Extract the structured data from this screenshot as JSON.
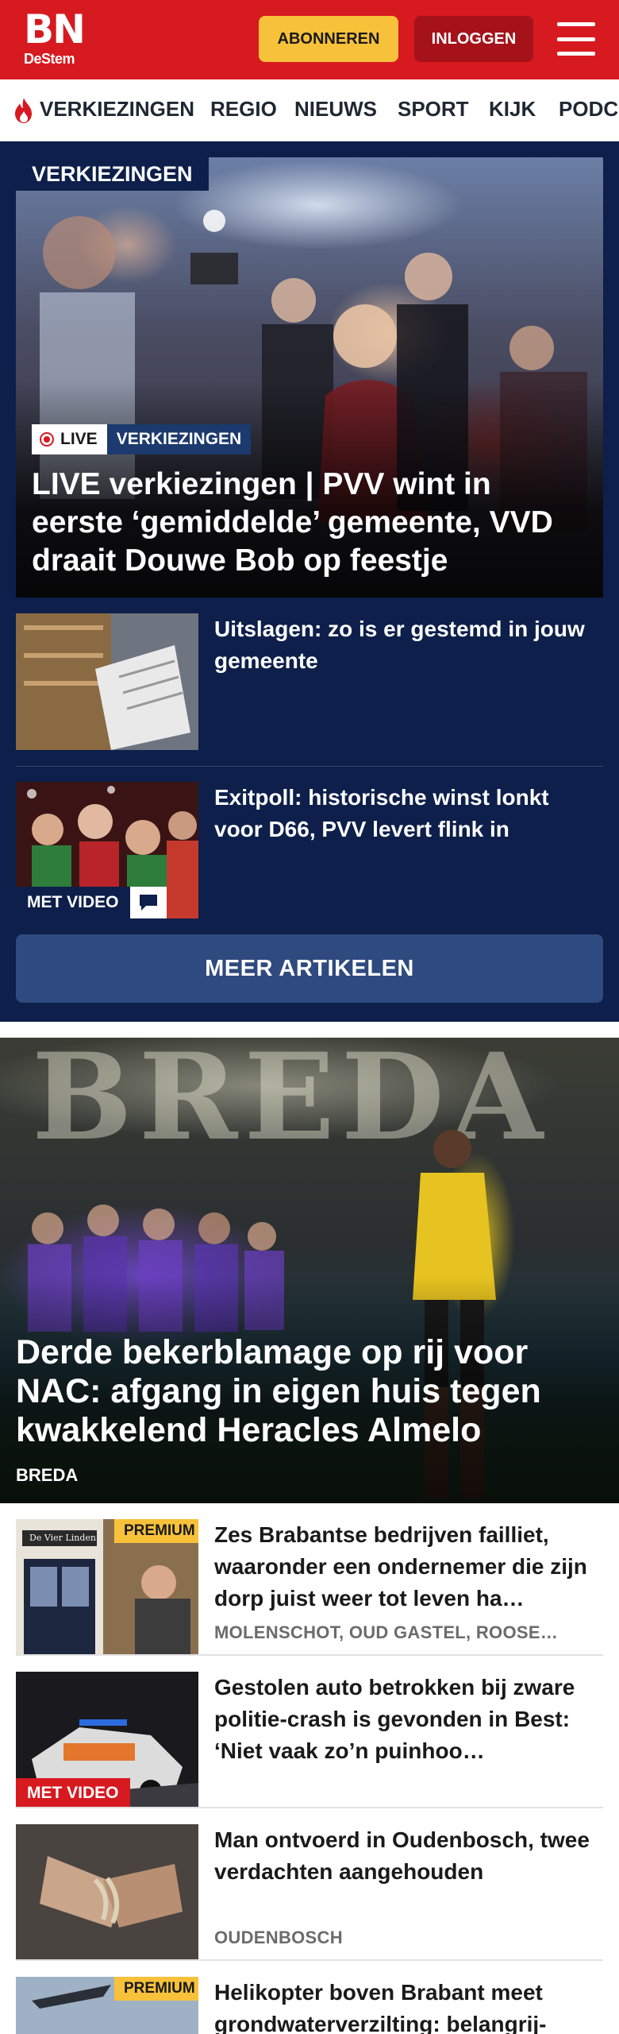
{
  "header": {
    "logo_main": "BN",
    "logo_sub": "DeStem",
    "subscribe_label": "ABONNEREN",
    "login_label": "INLOGGEN",
    "menu_icon": "hamburger-menu-icon",
    "brand_color": "#d71920"
  },
  "nav": {
    "items": [
      {
        "label": "VERKIEZINGEN",
        "icon": "flame-icon"
      },
      {
        "label": "REGIO"
      },
      {
        "label": "NIEUWS"
      },
      {
        "label": "SPORT"
      },
      {
        "label": "KIJK"
      },
      {
        "label": "PODC"
      }
    ]
  },
  "elections": {
    "section_label": "VERKIEZINGEN",
    "hero": {
      "live_label": "LIVE",
      "category": "VERKIEZINGEN",
      "title": "LIVE verkiezingen | PVV wint in eerste ‘gemiddelde’ gemeente, VVD draait Douwe Bob op feestje"
    },
    "articles": [
      {
        "title": "Uitslagen: zo is er gestemd in jouw gemeente"
      },
      {
        "title": "Exitpoll: historische winst lonkt voor D66, PVV levert flink in",
        "badge": "MET VIDEO",
        "badge_icon": "comment-icon"
      }
    ],
    "more_label": "MEER ARTIKELEN",
    "background_color": "#0d1f4a"
  },
  "feature": {
    "background_text": "BREDA",
    "title": "Derde bekerblamage op rij voor NAC: afgang in eigen huis tegen kwakkelend Heracles Almelo",
    "location": "BREDA"
  },
  "list": [
    {
      "title": "Zes Brabantse bedrijven failliet, waaronder een ondernemer die zijn dorp juist weer tot leven ha…",
      "location": "MOLENSCHOT, OUD GASTEL, ROOSE…",
      "badge": "PREMIUM",
      "shop_sign": "De Vier Linden"
    },
    {
      "title": "Gestolen auto betrokken bij zware politie-crash is gevonden in Best: ‘Niet vaak zo’n puinhoo…",
      "location": "",
      "badge": "MET VIDEO"
    },
    {
      "title": "Man ontvoerd in Oudenbosch, twee verdachten aangehouden",
      "location": "OUDENBOSCH",
      "badge": ""
    },
    {
      "title": "Helikopter boven Brabant meet grondwaterverzilting: belangrij-",
      "location": "",
      "badge": "PREMIUM"
    }
  ]
}
